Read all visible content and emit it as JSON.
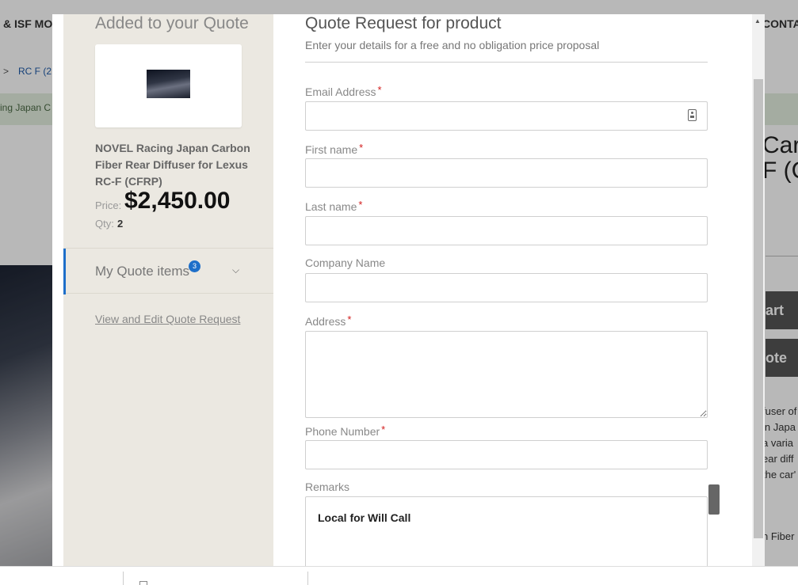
{
  "background": {
    "nav_left": "& ISF MO",
    "nav_right": "CONTA",
    "breadcrumb_sep": ">",
    "breadcrumb_item": "RC F (2",
    "banner_text": "ing Japan C",
    "title_line1": "Carb",
    "title_line2": "F (C",
    "button_cart": "art",
    "button_quote": "ote",
    "description_lines": [
      "fuser of",
      "in Japa",
      "a varia",
      "ear diff",
      "the car'"
    ],
    "footer_text": "n Fiber"
  },
  "side": {
    "title": "Added to your Quote",
    "product_name": "NOVEL Racing Japan Carbon Fiber Rear Diffuser for Lexus RC-F (CFRP)",
    "price_label": "Price:",
    "price_value": "$2,450.00",
    "qty_label": "Qty:",
    "qty_value": "2",
    "quote_items_label": "My Quote items",
    "quote_items_count": "3",
    "view_edit_link": "View and Edit Quote Request"
  },
  "form": {
    "title": "Quote Request for product",
    "subtitle": "Enter your details for a free and no obligation price proposal",
    "required_mark": "*",
    "fields": {
      "email": {
        "label": "Email Address",
        "value": ""
      },
      "first_name": {
        "label": "First name",
        "value": ""
      },
      "last_name": {
        "label": "Last name",
        "value": ""
      },
      "company": {
        "label": "Company Name",
        "value": ""
      },
      "address": {
        "label": "Address",
        "value": ""
      },
      "phone": {
        "label": "Phone Number",
        "value": ""
      },
      "remarks": {
        "label": "Remarks",
        "value": "Local for Will Call"
      }
    }
  },
  "icons": {
    "contact_card": "contact-card-icon",
    "chevron": "chevron-down-icon",
    "scroll_up": "scroll-up-icon"
  },
  "colors": {
    "accent": "#1e6fc9",
    "required": "#d21c1c",
    "side_panel": "#ebe8e1"
  }
}
